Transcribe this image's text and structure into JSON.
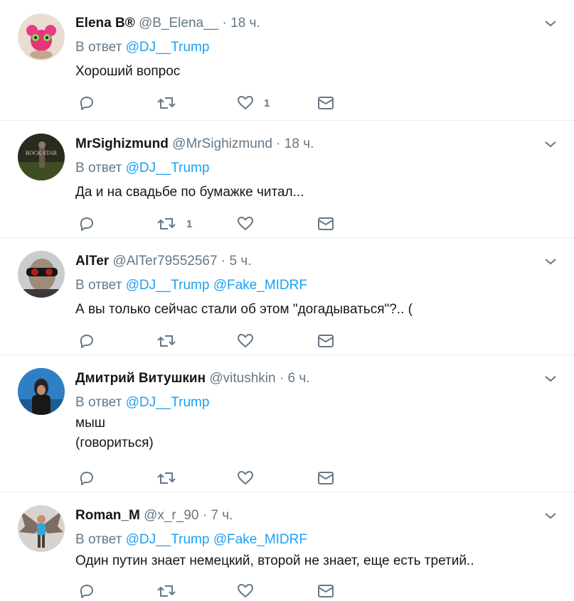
{
  "tweets": [
    {
      "name": "Elena B®",
      "handle": "@B_Elena__",
      "time": "18 ч.",
      "reply_prefix": "В ответ",
      "mentions": [
        "@DJ__Trump"
      ],
      "text_lines": [
        "Хороший вопрос"
      ],
      "retweets": "",
      "likes": "1"
    },
    {
      "name": "MrSighizmund",
      "handle": "@MrSighizmund",
      "time": "18 ч.",
      "reply_prefix": "В ответ",
      "mentions": [
        "@DJ__Trump"
      ],
      "text_lines": [
        "Да и на свадьбе по бумажке читал..."
      ],
      "retweets": "1",
      "likes": ""
    },
    {
      "name": "AlTer",
      "handle": "@AlTer79552567",
      "time": "5 ч.",
      "reply_prefix": "В ответ",
      "mentions": [
        "@DJ__Trump",
        "@Fake_MIDRF"
      ],
      "text_lines": [
        "А вы только сейчас стали об этом \"догадываться\"?.. ("
      ],
      "retweets": "",
      "likes": ""
    },
    {
      "name": "Дмитрий Витушкин",
      "handle": "@vitushkin",
      "time": "6 ч.",
      "reply_prefix": "В ответ",
      "mentions": [
        "@DJ__Trump"
      ],
      "text_lines": [
        "мыш",
        "(говориться)"
      ],
      "retweets": "",
      "likes": ""
    },
    {
      "name": "Roman_M",
      "handle": "@x_r_90",
      "time": "7 ч.",
      "reply_prefix": "В ответ",
      "mentions": [
        "@DJ__Trump",
        "@Fake_MIDRF"
      ],
      "text_lines": [
        "Один путин знает немецкий, второй не знает, еще есть третий.."
      ],
      "retweets": "",
      "likes": ""
    }
  ],
  "avatar_texts": {
    "t1": "ROCK STAR"
  },
  "icons": {
    "reply": "reply-icon",
    "retweet": "retweet-icon",
    "like": "heart-icon",
    "dm": "envelope-icon",
    "more": "chevron-down-icon"
  },
  "colors": {
    "link": "#1da1f2",
    "secondary_text": "#657786",
    "primary_text": "#14171a",
    "divider": "#e6ecf0"
  }
}
